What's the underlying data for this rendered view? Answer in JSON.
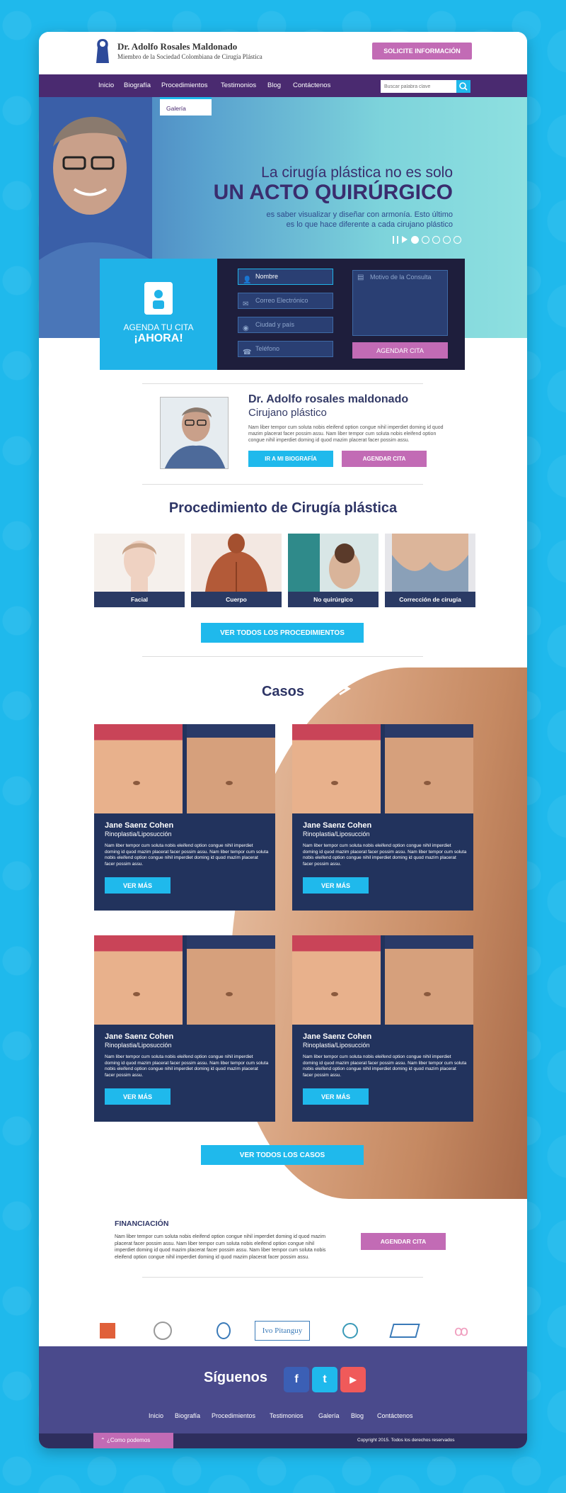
{
  "header": {
    "name": "Dr. Adolfo Rosales Maldonado",
    "subtitle": "Miembro de la Sociedad Colombiana de Cirugía Plástica",
    "cta": "SOLICITE INFORMACIÓN"
  },
  "nav": {
    "items": [
      "Inicio",
      "Biografía",
      "Procedimientos",
      "Testimonios",
      "Blog",
      "Contáctenos"
    ],
    "dropdown": "Galería",
    "search_placeholder": "Buscar palabra clave"
  },
  "hero": {
    "line1": "La cirugía plástica no es solo",
    "line2": "UN ACTO QUIRÚRGICO",
    "line3": "es saber visualizar y diseñar con armonía. Esto último",
    "line4": "es lo que hace diferente a cada cirujano plástico",
    "slides": 5,
    "active_slide": 1
  },
  "form": {
    "label1": "AGENDA TU CITA",
    "label2": "¡AHORA!",
    "name_value": "Nombre",
    "email_placeholder": "Correo Electrónico",
    "city_placeholder": "Ciudad y país",
    "phone_placeholder": "Teléfono",
    "reason_placeholder": "Motivo de la Consulta",
    "submit": "AGENDAR CITA"
  },
  "doctor": {
    "name": "Dr. Adolfo rosales maldonado",
    "role": "Cirujano plástico",
    "text": "Nam liber tempor cum soluta nobis eleifend option congue nihil imperdiet doming id quod mazim placerat facer possim assu. Nam liber tempor cum soluta nobis eleifend option congue nihil imperdiet doming id quod mazim placerat facer possim assu.",
    "btn_bio": "IR A MI BIOGRAFÍA",
    "btn_cita": "AGENDAR CITA"
  },
  "procedures": {
    "title": "Procedimiento de Cirugía plástica",
    "items": [
      "Facial",
      "Cuerpo",
      "No quirúrgico",
      "Corrección de cirugía"
    ],
    "btn": "VER TODOS LOS PROCEDIMIENTOS"
  },
  "cases": {
    "title": "Casos",
    "items": [
      {
        "name": "Jane Saenz Cohen",
        "proc": "Rinoplastia/Liposucción",
        "text": "Nam liber tempor cum soluta nobis eleifend option congue nihil imperdiet doming id quod mazim placerat facer possim assu. Nam liber tempor cum soluta nobis eleifend option congue nihil imperdiet doming id quod mazim placerat facer possim assu.",
        "btn": "VER MÁS"
      },
      {
        "name": "Jane Saenz Cohen",
        "proc": "Rinoplastia/Liposucción",
        "text": "Nam liber tempor cum soluta nobis eleifend option congue nihil imperdiet doming id quod mazim placerat facer possim assu. Nam liber tempor cum soluta nobis eleifend option congue nihil imperdiet doming id quod mazim placerat facer possim assu.",
        "btn": "VER MÁS"
      },
      {
        "name": "Jane Saenz Cohen",
        "proc": "Rinoplastia/Liposucción",
        "text": "Nam liber tempor cum soluta nobis eleifend option congue nihil imperdiet doming id quod mazim placerat facer possim assu. Nam liber tempor cum soluta nobis eleifend option congue nihil imperdiet doming id quod mazim placerat facer possim assu.",
        "btn": "VER MÁS"
      },
      {
        "name": "Jane Saenz Cohen",
        "proc": "Rinoplastia/Liposucción",
        "text": "Nam liber tempor cum soluta nobis eleifend option congue nihil imperdiet doming id quod mazim placerat facer possim assu. Nam liber tempor cum soluta nobis eleifend option congue nihil imperdiet doming id quod mazim placerat facer possim assu.",
        "btn": "VER MÁS"
      }
    ],
    "btn": "VER TODOS LOS CASOS"
  },
  "financing": {
    "title": "FINANCIACIÓN",
    "text": "Nam liber tempor cum soluta nobis eleifend option congue nihil imperdiet doming id quod mazim placerat facer possim assu. Nam liber tempor cum soluta nobis eleifend option congue nihil imperdiet doming id quod mazim placerat facer possim assu. Nam liber tempor cum soluta nobis eleifend option congue nihil imperdiet doming id quod mazim placerat facer possim assu.",
    "btn": "AGENDAR CITA"
  },
  "partners": [
    "Ivo Pitanguy"
  ],
  "footer": {
    "follow": "Síguenos",
    "social": [
      "f",
      "t",
      "▶"
    ],
    "links": [
      "Inicio",
      "Biografía",
      "Procedimientos",
      "Testimonios",
      "Galería",
      "Blog",
      "Contáctenos"
    ],
    "help": "¿Como podemos ayudarle?",
    "copyright": "Copyright 2015. Todos los derechos reservados"
  },
  "colors": {
    "cyan": "#1fb9ec",
    "purple": "#4a2a70",
    "pink": "#c26bb5",
    "navy": "#22335d"
  }
}
